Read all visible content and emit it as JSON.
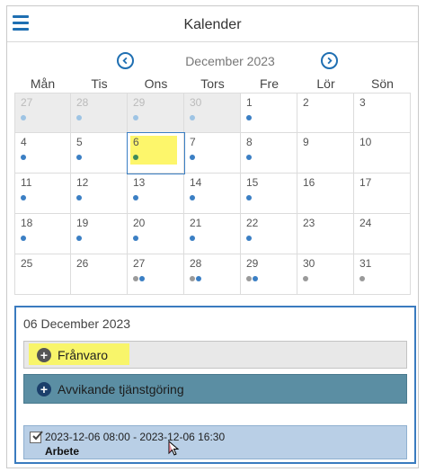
{
  "header": {
    "title": "Kalender"
  },
  "calendar": {
    "month_label": "December 2023",
    "weekdays": [
      "Mån",
      "Tis",
      "Ons",
      "Tors",
      "Fre",
      "Lör",
      "Sön"
    ],
    "colors": {
      "blue_dot": "#3b7fc4",
      "light_blue_dot": "#9ec4e4",
      "green_dot": "#3d8a5a",
      "gray_dot": "#9a9a9a",
      "highlight": "#fdf66b"
    },
    "days": [
      {
        "num": "27",
        "other": true,
        "dots": [
          "light_blue_dot"
        ]
      },
      {
        "num": "28",
        "other": true,
        "dots": [
          "light_blue_dot"
        ]
      },
      {
        "num": "29",
        "other": true,
        "dots": [
          "light_blue_dot"
        ]
      },
      {
        "num": "30",
        "other": true,
        "dots": [
          "light_blue_dot"
        ]
      },
      {
        "num": "1",
        "other": false,
        "dots": [
          "blue_dot"
        ]
      },
      {
        "num": "2",
        "other": false,
        "dots": []
      },
      {
        "num": "3",
        "other": false,
        "dots": []
      },
      {
        "num": "4",
        "other": false,
        "dots": [
          "blue_dot"
        ]
      },
      {
        "num": "5",
        "other": false,
        "dots": [
          "blue_dot"
        ]
      },
      {
        "num": "6",
        "other": false,
        "dots": [
          "green_dot"
        ],
        "selected": true
      },
      {
        "num": "7",
        "other": false,
        "dots": [
          "blue_dot"
        ]
      },
      {
        "num": "8",
        "other": false,
        "dots": [
          "blue_dot"
        ]
      },
      {
        "num": "9",
        "other": false,
        "dots": []
      },
      {
        "num": "10",
        "other": false,
        "dots": []
      },
      {
        "num": "11",
        "other": false,
        "dots": [
          "blue_dot"
        ]
      },
      {
        "num": "12",
        "other": false,
        "dots": [
          "blue_dot"
        ]
      },
      {
        "num": "13",
        "other": false,
        "dots": [
          "blue_dot"
        ]
      },
      {
        "num": "14",
        "other": false,
        "dots": [
          "blue_dot"
        ]
      },
      {
        "num": "15",
        "other": false,
        "dots": [
          "blue_dot"
        ]
      },
      {
        "num": "16",
        "other": false,
        "dots": []
      },
      {
        "num": "17",
        "other": false,
        "dots": []
      },
      {
        "num": "18",
        "other": false,
        "dots": [
          "blue_dot"
        ]
      },
      {
        "num": "19",
        "other": false,
        "dots": [
          "blue_dot"
        ]
      },
      {
        "num": "20",
        "other": false,
        "dots": [
          "blue_dot"
        ]
      },
      {
        "num": "21",
        "other": false,
        "dots": [
          "blue_dot"
        ]
      },
      {
        "num": "22",
        "other": false,
        "dots": [
          "blue_dot"
        ]
      },
      {
        "num": "23",
        "other": false,
        "dots": []
      },
      {
        "num": "24",
        "other": false,
        "dots": []
      },
      {
        "num": "25",
        "other": false,
        "dots": []
      },
      {
        "num": "26",
        "other": false,
        "dots": []
      },
      {
        "num": "27",
        "other": false,
        "dots": [
          "gray_dot",
          "blue_dot"
        ]
      },
      {
        "num": "28",
        "other": false,
        "dots": [
          "gray_dot",
          "blue_dot"
        ]
      },
      {
        "num": "29",
        "other": false,
        "dots": [
          "gray_dot",
          "blue_dot"
        ]
      },
      {
        "num": "30",
        "other": false,
        "dots": [
          "gray_dot"
        ]
      },
      {
        "num": "31",
        "other": false,
        "dots": [
          "gray_dot"
        ]
      }
    ]
  },
  "details": {
    "date": "06 December 2023",
    "franvaro_label": "Frånvaro",
    "avvikande_label": "Avvikande tjänstgöring",
    "event": {
      "time": "2023-12-06 08:00 - 2023-12-06 16:30",
      "type": "Arbete"
    }
  }
}
